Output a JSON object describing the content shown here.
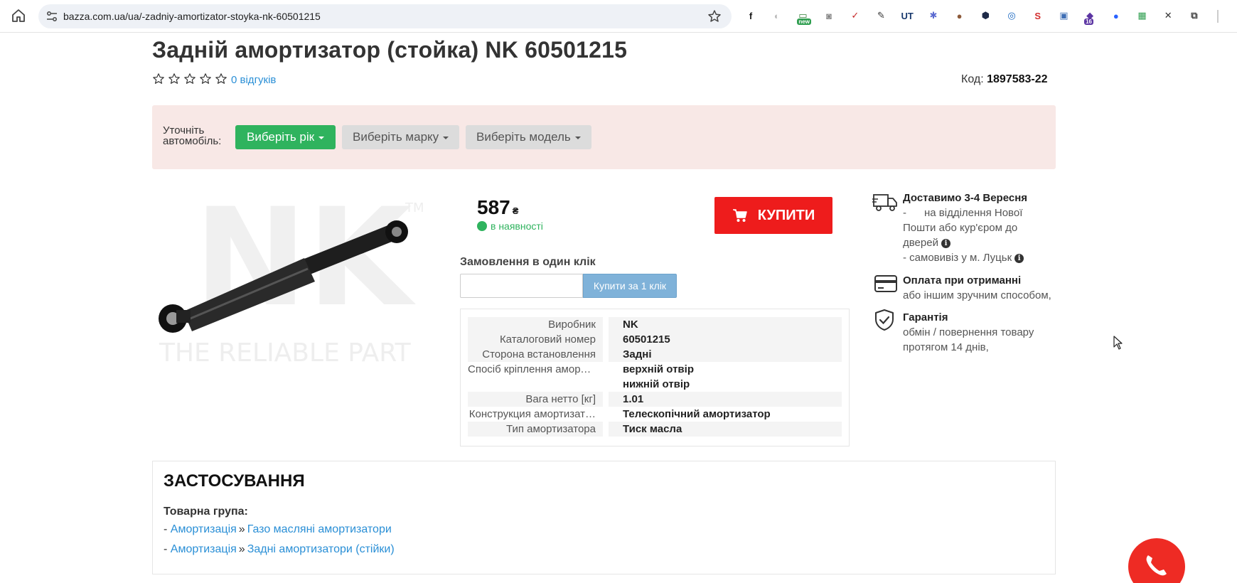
{
  "browser": {
    "url": "bazza.com.ua/ua/-zadniy-amortizator-stoyka-nk-60501215",
    "extensions": [
      {
        "name": "extension-f-icon",
        "glyph": "f",
        "color": "#1a1a1a"
      },
      {
        "name": "extension-drop-icon",
        "glyph": "◐",
        "color": "#bbbbbb"
      },
      {
        "name": "extension-new-icon",
        "glyph": "▭",
        "color": "#2e7d32",
        "badge": "new"
      },
      {
        "name": "extension-camera-icon",
        "glyph": "◙",
        "color": "#888888"
      },
      {
        "name": "extension-check-icon",
        "glyph": "✓",
        "color": "#c62828"
      },
      {
        "name": "extension-pen-icon",
        "glyph": "✎",
        "color": "#333333"
      },
      {
        "name": "extension-ut-icon",
        "glyph": "UT",
        "color": "#1a3a6e"
      },
      {
        "name": "extension-gear-icon",
        "glyph": "✱",
        "color": "#5b6ad0"
      },
      {
        "name": "extension-cookie-icon",
        "glyph": "●",
        "color": "#8d5a3a"
      },
      {
        "name": "extension-hex-icon",
        "glyph": "⬢",
        "color": "#1e2a48"
      },
      {
        "name": "extension-lens-icon",
        "glyph": "◎",
        "color": "#1565c0"
      },
      {
        "name": "extension-s-icon",
        "glyph": "S",
        "color": "#d32f2f"
      },
      {
        "name": "extension-photo-icon",
        "glyph": "▣",
        "color": "#3f6fb5"
      },
      {
        "name": "extension-counter-icon",
        "glyph": "◆",
        "color": "#5c35a3",
        "badge": "16"
      },
      {
        "name": "extension-dot-icon",
        "glyph": "●",
        "color": "#2962ff"
      },
      {
        "name": "extension-grid-icon",
        "glyph": "▦",
        "color": "#2e9e4f"
      },
      {
        "name": "extension-x-icon",
        "glyph": "✕",
        "color": "#333333"
      },
      {
        "name": "extensions-puzzle-icon",
        "glyph": "⧉",
        "color": "#444444"
      }
    ]
  },
  "product": {
    "title": "Задній амортизатор (стойка) NK 60501215",
    "reviews": "0 відгуків",
    "code_label": "Код:",
    "code_value": "1897583-22",
    "price": "587",
    "currency": "₴",
    "stock": "в наявності",
    "buy_label": "КУПИТИ",
    "image_caption": "THE RELIABLE PART",
    "brand_mark": "NK",
    "tm": "TM"
  },
  "car_filter": {
    "label": "Уточніть автомобіль:",
    "year": "Виберіть рік",
    "make": "Виберіть марку",
    "model": "Виберіть модель"
  },
  "oneclick": {
    "title": "Замовлення в один клік",
    "input_placeholder": "",
    "button": "Купити за 1 клік"
  },
  "specs": [
    {
      "key": "Виробник",
      "value": "NK"
    },
    {
      "key": "Каталоговий номер",
      "value": "60501215"
    },
    {
      "key": "Сторона встановлення",
      "value": "Задні"
    },
    {
      "key": "Спосіб кріплення аморт…",
      "value": "верхній отвір"
    },
    {
      "key": "",
      "value": "нижній отвір"
    },
    {
      "key": "Вага нетто [кг]",
      "value": "1.01"
    },
    {
      "key": "Конструкция амортизат…",
      "value": "Телескопічний амортизатор"
    },
    {
      "key": "Тип амортизатора",
      "value": "Тиск масла"
    }
  ],
  "delivery": {
    "title": "Доставимо 3-4 Вересня",
    "line1": "-      на відділення Нової Пошти або кур'єром до дверей",
    "line2": "- самовивіз у м. Луцьк"
  },
  "payment": {
    "title": "Оплата при отриманні",
    "text": "або іншим зручним способом,"
  },
  "warranty": {
    "title": "Гарантія",
    "text": "обмін / повернення товару протягом 14 днів,"
  },
  "application": {
    "heading": "ЗАСТОСУВАННЯ",
    "group_label": "Товарна група:",
    "rows": [
      {
        "parent": "Амортизація",
        "child": "Газо масляні амортизатори"
      },
      {
        "parent": "Амортизація",
        "child": "Задні амортизатори (стійки)"
      }
    ]
  },
  "colors": {
    "accent_green": "#2fb35e",
    "buy_red": "#ee1c1c",
    "link_blue": "#2a8fd6",
    "filter_bg": "#f8e8e6"
  }
}
